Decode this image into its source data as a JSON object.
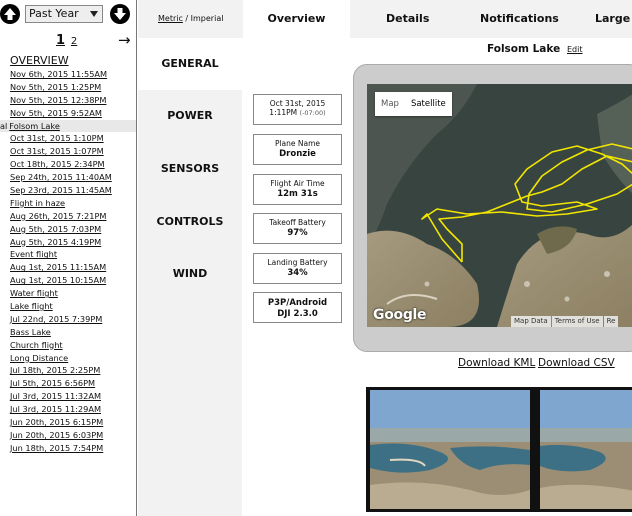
{
  "sidebar": {
    "range": "Past Year",
    "pages": [
      "1",
      "2"
    ],
    "overview_label": "OVERVIEW",
    "flights": [
      "Nov 6th, 2015 11:55AM",
      "Nov 5th, 2015 1:25PM",
      "Nov 5th, 2015 12:38PM",
      "Nov 5th, 2015 9:52AM",
      "Folsom Lake",
      "Oct 31st, 2015 1:10PM",
      "Oct 31st, 2015 1:07PM",
      "Oct 18th, 2015 2:34PM",
      "Sep 24th, 2015 11:40AM",
      "Sep 23rd, 2015 11:45AM",
      "Flight in haze",
      "Aug 26th, 2015 7:21PM",
      "Aug 5th, 2015 7:03PM",
      "Aug 5th, 2015 4:19PM",
      "Event flight",
      "Aug 1st, 2015 11:15AM",
      "Aug 1st, 2015 10:15AM",
      "Water flight",
      "Lake flight",
      "Jul 22nd, 2015 7:39PM",
      "Bass Lake",
      "Church flight",
      "Long Distance",
      "Jul 18th, 2015 2:25PM",
      "Jul 5th, 2015 6:56PM",
      "Jul 3rd, 2015 11:32AM",
      "Jul 3rd, 2015 11:29AM",
      "Jun 20th, 2015 6:15PM",
      "Jun 20th, 2015 6:03PM",
      "Jun 18th, 2015 7:54PM"
    ],
    "active_index": 4,
    "active_lead": "al"
  },
  "units": {
    "metric": "Metric",
    "sep": " / ",
    "imperial": "Imperial"
  },
  "tabs": {
    "overview": "Overview",
    "details": "Details",
    "notifications": "Notifications",
    "large": "Large M"
  },
  "sections": {
    "general": "GENERAL",
    "power": "POWER",
    "sensors": "SENSORS",
    "controls": "CONTROLS",
    "wind": "WIND"
  },
  "summary": {
    "date": "Oct 31st, 2015",
    "time": "1:11PM",
    "tz": "(-07:00)",
    "plane_label": "Plane Name",
    "plane_value": "Dronzie",
    "air_label": "Flight Air Time",
    "air_value": "12m 31s",
    "takeoff_label": "Takeoff Battery",
    "takeoff_value": "97%",
    "landing_label": "Landing Battery",
    "landing_value": "34%",
    "app_label": "P3P/Android",
    "app_value": "DJI 2.3.0"
  },
  "flight_title": "Folsom Lake",
  "edit_label": "Edit",
  "map": {
    "type_map": "Map",
    "type_satellite": "Satellite",
    "logo": "Google",
    "attrib": [
      "Map Data",
      "Terms of Use",
      "Re"
    ]
  },
  "downloads": {
    "kml": "Download KML",
    "csv": "Download CSV"
  },
  "colors": {
    "flight_path": "#f2e600",
    "panel_gray": "#f2f2f2"
  }
}
